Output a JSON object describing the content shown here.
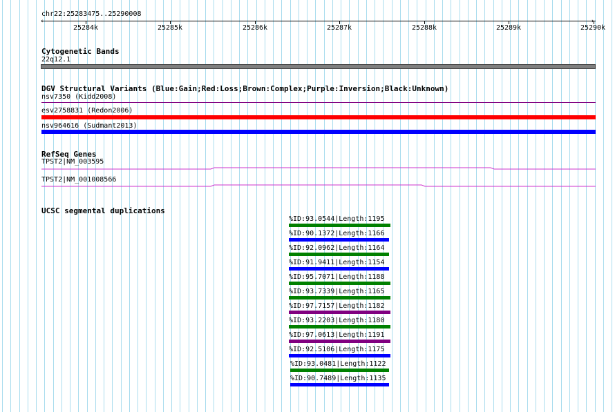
{
  "position": "chr22:25283475..25290008",
  "ruler": {
    "ticks": [
      "25284k",
      "25285k",
      "25286k",
      "25287k",
      "25288k",
      "25289k",
      "25290k"
    ]
  },
  "tracks": {
    "cytoband": {
      "title": "Cytogenetic Bands",
      "band": "22q12.1",
      "color": "#7f7f7f"
    },
    "dgv": {
      "title": "DGV Structural Variants (Blue:Gain;Red:Loss;Brown:Complex;Purple:Inversion;Black:Unknown)",
      "features": [
        {
          "label": "nsv7350 (Kidd2008)",
          "color": "#800080"
        },
        {
          "label": "esv2758831 (Redon2006)",
          "color": "#ff0000"
        },
        {
          "label": "nsv964616 (Sudmant2013)",
          "color": "#0000ff"
        }
      ]
    },
    "refseq": {
      "title": "RefSeq Genes",
      "features": [
        {
          "label": "TPST2|NM_003595",
          "color": "#cc33cc"
        },
        {
          "label": "TPST2|NM_001008566",
          "color": "#cc33cc"
        }
      ]
    },
    "segdup": {
      "title": "UCSC segmental duplications",
      "features": [
        {
          "label": "%ID:93.0544|Length:1195",
          "color": "#008000"
        },
        {
          "label": "%ID:90.1372|Length:1166",
          "color": "#0000ff"
        },
        {
          "label": "%ID:92.0962|Length:1164",
          "color": "#008000"
        },
        {
          "label": "%ID:91.9411|Length:1154",
          "color": "#0000ff"
        },
        {
          "label": "%ID:95.7071|Length:1188",
          "color": "#008000"
        },
        {
          "label": "%ID:93.7339|Length:1165",
          "color": "#008000"
        },
        {
          "label": "%ID:97.7157|Length:1182",
          "color": "#800080"
        },
        {
          "label": "%ID:93.2203|Length:1180",
          "color": "#008000"
        },
        {
          "label": "%ID:97.0613|Length:1191",
          "color": "#800080"
        },
        {
          "label": "%ID:92.5106|Length:1175",
          "color": "#0000ff"
        },
        {
          "label": "%ID:93.0481|Length:1122",
          "color": "#008000"
        },
        {
          "label": "%ID:90.7489|Length:1135",
          "color": "#0000ff"
        }
      ]
    }
  },
  "colors": {
    "gridline": "#a8dcee",
    "ruler": "#000000"
  }
}
